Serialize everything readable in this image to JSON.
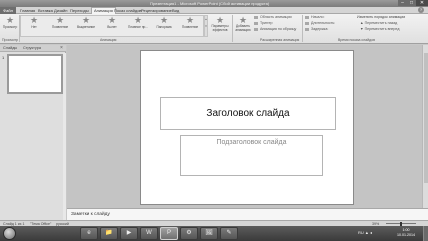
{
  "window": {
    "title": "Презентация1 - Microsoft PowerPoint (Сбой активации продукта)",
    "min": "–",
    "max": "□",
    "close": "✕"
  },
  "tabs": {
    "file": "Файл",
    "items": [
      "Главная",
      "Вставка",
      "Дизайн",
      "Переходы",
      "Анимация",
      "Показ слайдов",
      "Рецензирование",
      "Вид"
    ],
    "active_index": 4,
    "help": "?"
  },
  "ribbon": {
    "preview": {
      "label": "Просмотр",
      "group": "Просмотр"
    },
    "animations": {
      "items": [
        "Нет",
        "Появление",
        "Выцветание",
        "Вылет",
        "Плавное пр...",
        "Панорама",
        "Появление"
      ],
      "group": "Анимация"
    },
    "effects_params": {
      "label": "Параметры эффектов"
    },
    "add_animation": {
      "label": "Добавить анимацию"
    },
    "advanced": {
      "lines": [
        "Область анимации",
        "Триггер",
        "Анимация по образцу"
      ],
      "group": "Расширенная анимация"
    },
    "timing": {
      "lines": [
        "Начало:",
        "Длительность:",
        "Задержка:"
      ],
      "group": "Время показа слайдов"
    },
    "reorder": {
      "title": "Изменить порядок анимации",
      "lines": [
        "Переместить назад",
        "Переместить вперед"
      ]
    }
  },
  "left_panel": {
    "tabs": [
      "Слайды",
      "Структура"
    ],
    "close": "×",
    "thumb_number": "1"
  },
  "slide": {
    "title": "Заголовок слайда",
    "subtitle": "Подзаголовок слайда"
  },
  "notes": {
    "text": "Заметки к слайду"
  },
  "status": {
    "slide": "Слайд 1 из 1",
    "theme": "\"Тема Office\"",
    "lang": "русский",
    "zoom": "39%"
  },
  "taskbar": {
    "buttons": [
      "e",
      "📁",
      "▶",
      "W",
      "P",
      "⚙",
      "🖼",
      "✎"
    ],
    "tray": "RU ▲ ◂",
    "time": "1:00",
    "date": "10.01.2014"
  }
}
